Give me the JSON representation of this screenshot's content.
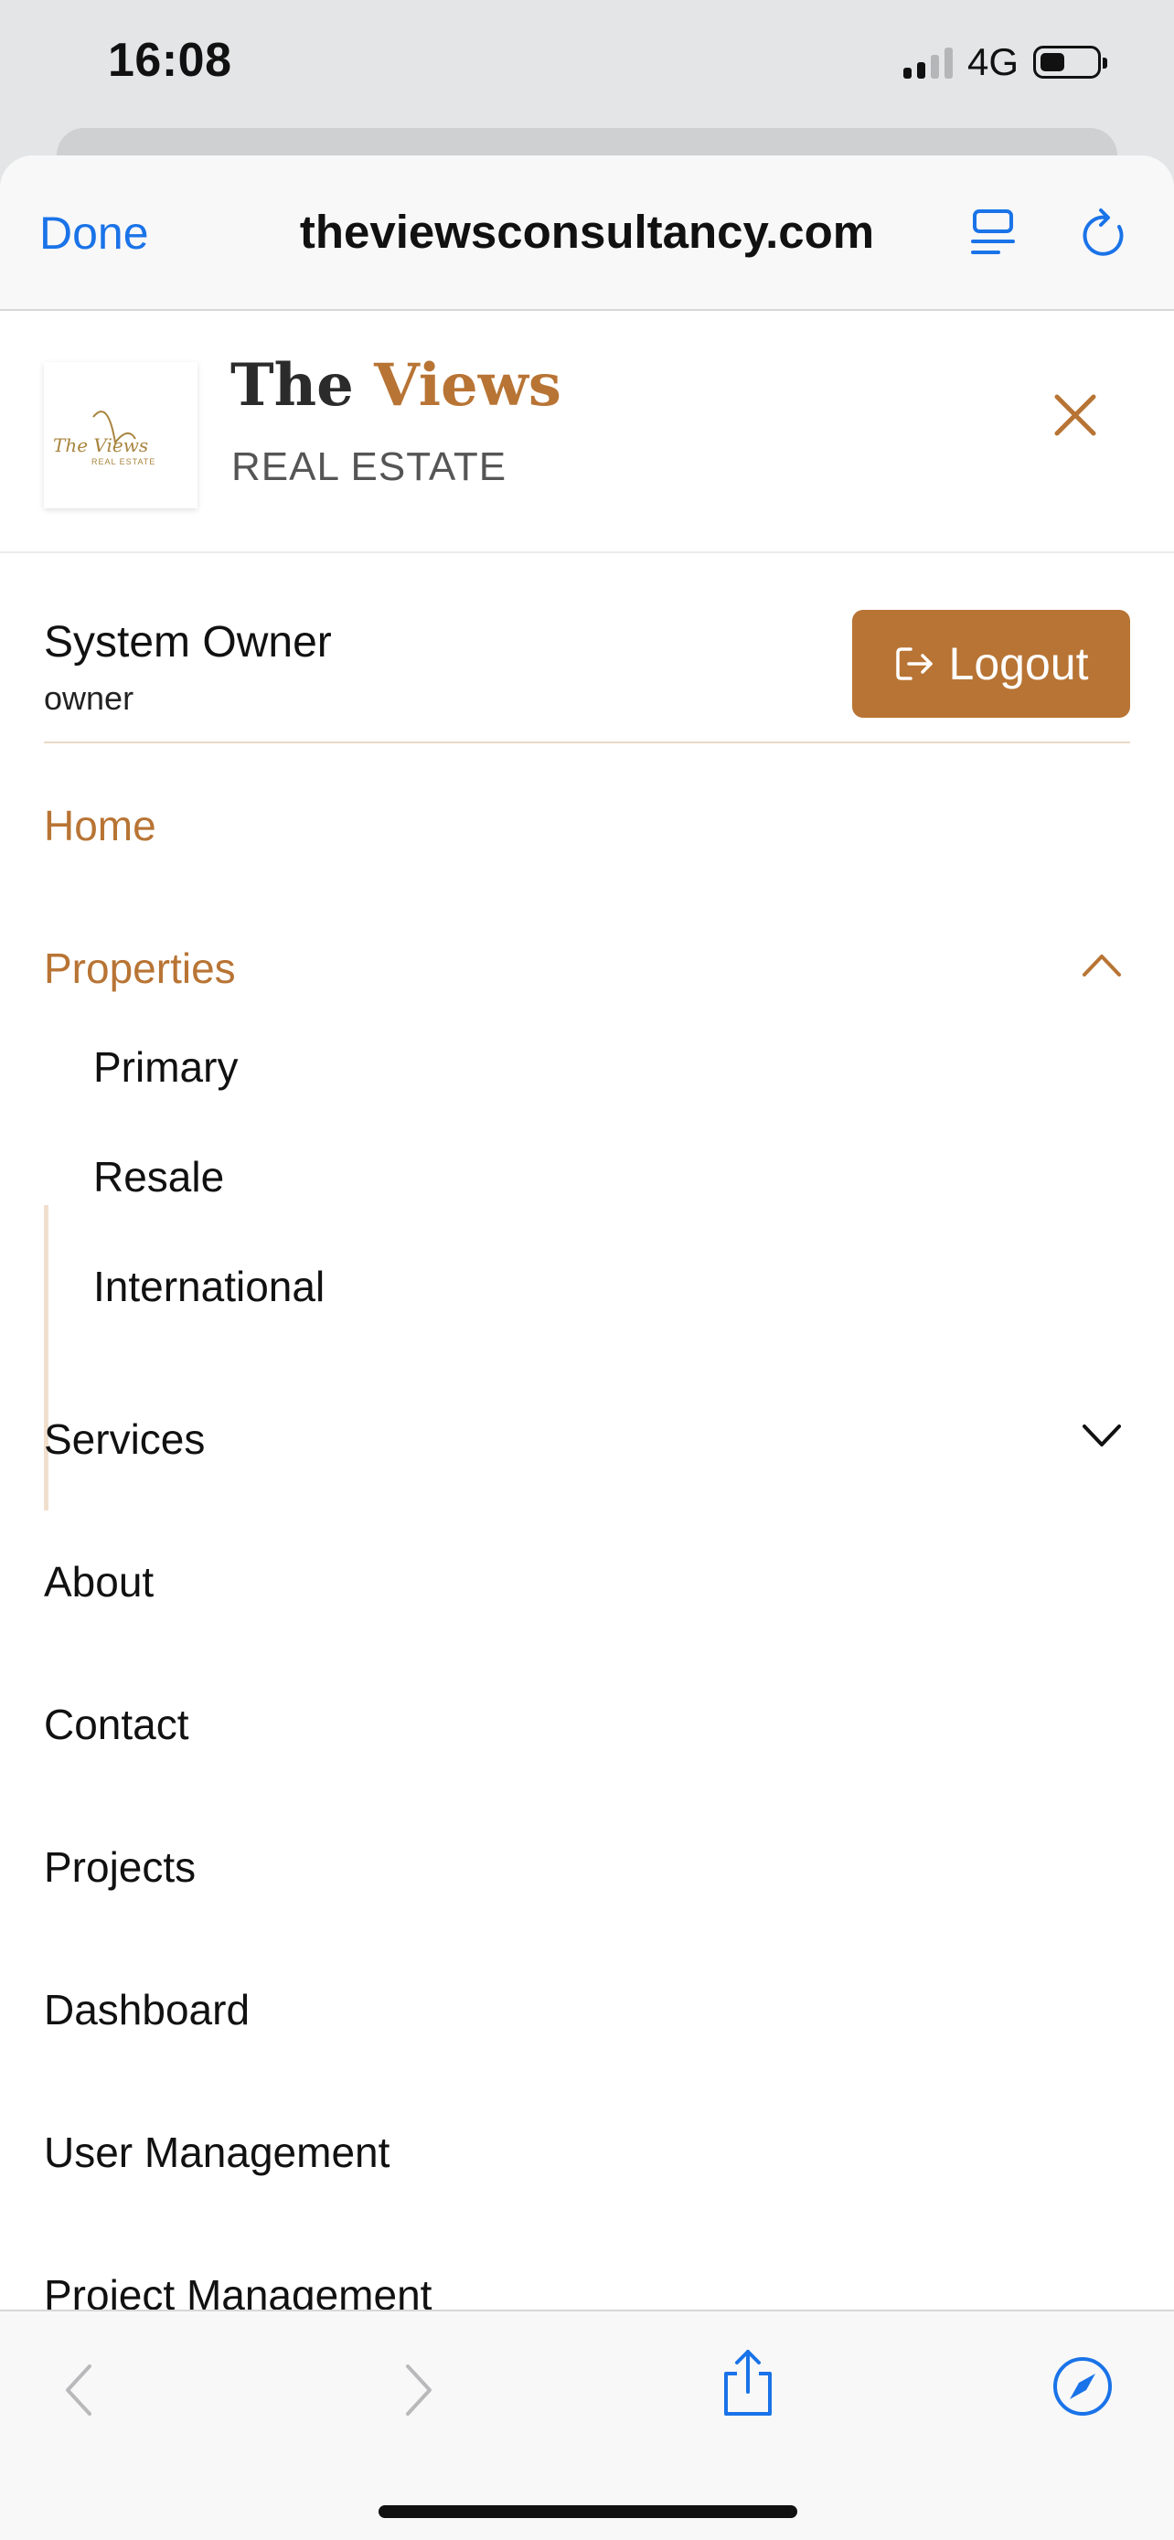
{
  "status_bar": {
    "time": "16:08",
    "network": "4G"
  },
  "browser": {
    "done_label": "Done",
    "url": "theviewsconsultancy.com"
  },
  "site": {
    "brand_title_main": "The",
    "brand_title_accent": "Views",
    "brand_subtitle": "REAL ESTATE",
    "logo_text": "The Views",
    "logo_subtext": "REAL ESTATE"
  },
  "user": {
    "name": "System Owner",
    "role": "owner",
    "logout_label": "Logout"
  },
  "nav": {
    "home": "Home",
    "properties": "Properties",
    "properties_sub": [
      "Primary",
      "Resale",
      "International"
    ],
    "services": "Services",
    "about": "About",
    "contact": "Contact",
    "projects": "Projects",
    "dashboard": "Dashboard",
    "user_management": "User Management",
    "cut_off_item": "Project Management"
  },
  "colors": {
    "accent": "#b87434",
    "safari_blue": "#1a73e8"
  }
}
